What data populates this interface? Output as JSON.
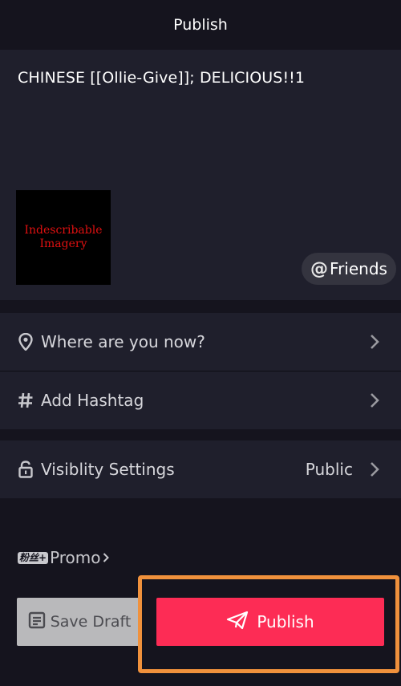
{
  "header": {
    "title": "Publish"
  },
  "caption": {
    "text": "CHINESE [[Ollie-Give]]; DELICIOUS!!1"
  },
  "thumbnail": {
    "line1": "Indescribable",
    "line2": "Imagery"
  },
  "mention": {
    "at": "@",
    "label": "Friends"
  },
  "location": {
    "label": "Where are you now?",
    "icon": "location-pin-icon"
  },
  "hashtag": {
    "label": "Add Hashtag",
    "icon": "hashtag-icon"
  },
  "visibility": {
    "label": "Visiblity Settings",
    "value": "Public",
    "icon": "lock-icon"
  },
  "promo": {
    "badge": "粉丝+",
    "label": "Promo"
  },
  "actions": {
    "save_label": "Save Draft",
    "publish_label": "Publish"
  },
  "colors": {
    "accent": "#fd2c55",
    "highlight": "#f0913c",
    "panel": "#1f1f2c",
    "background": "#15141e"
  }
}
